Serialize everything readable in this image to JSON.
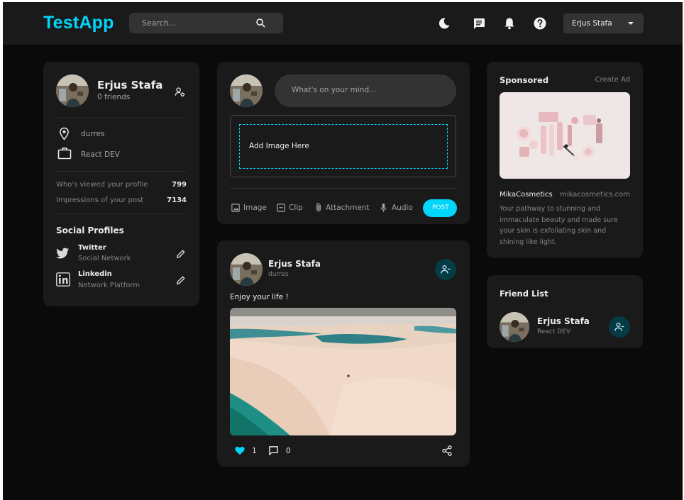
{
  "navbar": {
    "brand": "TestApp",
    "search_placeholder": "Search...",
    "user_name": "Erjus Stafa",
    "icons": [
      "moon-icon",
      "message-icon",
      "bell-icon",
      "help-icon"
    ]
  },
  "profile": {
    "name": "Erjus Stafa",
    "friends": "0 friends",
    "location": "durres",
    "occupation": "React DEV",
    "stats": [
      {
        "label": "Who's viewed your profile",
        "value": "799"
      },
      {
        "label": "Impressions of your post",
        "value": "7134"
      }
    ],
    "social_title": "Social Profiles",
    "socials": [
      {
        "name": "Twitter",
        "sub": "Social Network"
      },
      {
        "name": "Linkedin",
        "sub": "Network Platform"
      }
    ]
  },
  "composer": {
    "placeholder": "What's on your mind...",
    "dropzone": "Add Image Here",
    "actions": [
      "Image",
      "Clip",
      "Attachment",
      "Audio"
    ],
    "post_label": "POST"
  },
  "post": {
    "author": "Erjus Stafa",
    "location": "durres",
    "text": "Enjoy your life !",
    "likes": "1",
    "comments": "0"
  },
  "sponsored": {
    "title": "Sponsored",
    "create_ad": "Create Ad",
    "brand": "MikaCosmetics",
    "site": "mikacosmetics.com",
    "description_lines": [
      "Your pathway to stunning and",
      "immaculate beauty and made sure",
      "your skin is exfoliating skin and",
      "shining like light."
    ]
  },
  "friends": {
    "title": "Friend List",
    "items": [
      {
        "name": "Erjus Stafa",
        "sub": "React DEV"
      }
    ]
  },
  "colors": {
    "accent": "#00d5fa",
    "background": "#0a0a0a",
    "card": "#1a1a1a"
  }
}
